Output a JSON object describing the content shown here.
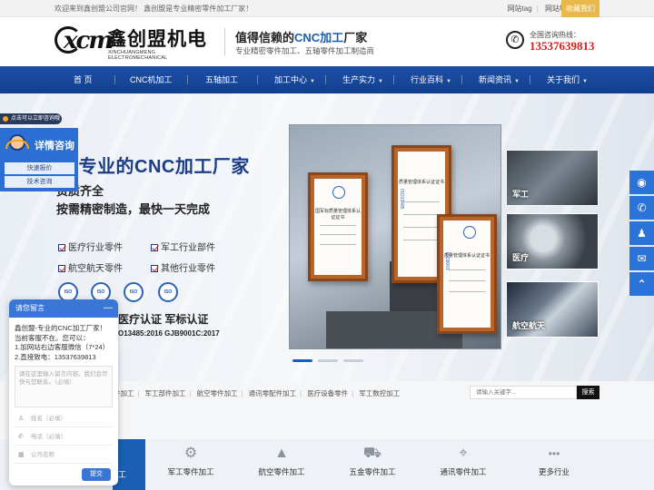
{
  "topbar": {
    "welcome": "欢迎来到鑫创盟公司官网！ 鑫创盟是专业精密零件加工厂家！",
    "links": [
      "网站tag",
      "网站地图"
    ],
    "favorite": "收藏我们"
  },
  "header": {
    "logo_mark": "xcm",
    "logo_cn": "鑫创盟机电",
    "logo_en": "XINCHUANGMENG ELECTROMECHANICAL",
    "slogan_prefix": "值得信赖的",
    "slogan_highlight": "CNC加工",
    "slogan_suffix": "厂家",
    "slogan_sub": "专业精密零件加工、五轴零件加工制造商",
    "hotline_label": "全国咨询热线：",
    "hotline_number": "13537639813"
  },
  "nav": {
    "items": [
      {
        "label": "首 页",
        "caret": false
      },
      {
        "label": "CNC机加工",
        "caret": false
      },
      {
        "label": "五轴加工",
        "caret": false
      },
      {
        "label": "加工中心",
        "caret": true
      },
      {
        "label": "生产实力",
        "caret": true
      },
      {
        "label": "行业百科",
        "caret": true
      },
      {
        "label": "新闻资讯",
        "caret": true
      },
      {
        "label": "关于我们",
        "caret": true
      }
    ]
  },
  "banner": {
    "headline": "内专业的CNC加工厂家",
    "sub1": "资质齐全",
    "sub2": "按需精密制造，最快一天完成",
    "categories": [
      "医疗行业零件",
      "军工行业部件",
      "航空航天零件",
      "其他行业零件"
    ],
    "badges": [
      "ISO",
      "ISO",
      "ISO",
      "ISO"
    ],
    "cert_text": "医疗认证  军标认证",
    "cert_code": "O13485:2016  GJB9001C:2017",
    "thumbs": [
      "军工",
      "医疗",
      "航空航天"
    ],
    "certificates": [
      {
        "title": "国军标质量管理体系认证证书",
        "side": ""
      },
      {
        "title": "质量管理体系认证证书",
        "side": "ISO13485"
      },
      {
        "title": "质量管理体系认证证书",
        "side": "ISO9001"
      }
    ],
    "slide_count": 3,
    "active_slide": 0
  },
  "consult": {
    "tag": "点击可以立即咨询哦",
    "title": "详情咨询",
    "buttons": [
      "快速报价",
      "技术咨询"
    ]
  },
  "chat": {
    "title": "请您留言",
    "minimize": "—",
    "message_lines": [
      "鑫创盟-专业的CNC加工厂家！",
      "当前客服不在。您可以：",
      "1.加网站右边客服微信（7*24）",
      "2.直接致电：13537639813"
    ],
    "textarea_placeholder": "请在这里输入留言内容。我们会尽快与您联系。（必填）",
    "fields": [
      {
        "icon": "person-icon",
        "placeholder": "姓名（必填）"
      },
      {
        "icon": "phone-icon",
        "placeholder": "电话（必填）"
      },
      {
        "icon": "building-icon",
        "placeholder": "公司名称"
      }
    ],
    "send": "提交"
  },
  "right_float": [
    {
      "icon": "wechat-icon",
      "glyph": "◉"
    },
    {
      "icon": "whatsapp-icon",
      "glyph": "✆"
    },
    {
      "icon": "qq-icon",
      "glyph": "♟"
    },
    {
      "icon": "mail-icon",
      "glyph": "✉"
    },
    {
      "icon": "back-to-top-icon",
      "glyph": "⌃"
    }
  ],
  "category_links": [
    "件加工",
    "军工部件加工",
    "航空零件加工",
    "通讯零配件加工",
    "医疗设备零件",
    "军工数控加工"
  ],
  "search": {
    "placeholder": "请输入关键字...",
    "button": "搜索"
  },
  "products": {
    "active_label_top": "",
    "active_label": "工",
    "items": [
      {
        "icon": "machine-icon",
        "glyph": "⚙",
        "label": "军工零件加工"
      },
      {
        "icon": "rocket-icon",
        "glyph": "▲",
        "label": "航空零件加工"
      },
      {
        "icon": "car-icon",
        "glyph": "⛟",
        "label": "五金零件加工"
      },
      {
        "icon": "antenna-icon",
        "glyph": "⌖",
        "label": "通讯零件加工"
      },
      {
        "icon": "more-icon",
        "glyph": "•••",
        "label": "更多行业"
      }
    ]
  }
}
